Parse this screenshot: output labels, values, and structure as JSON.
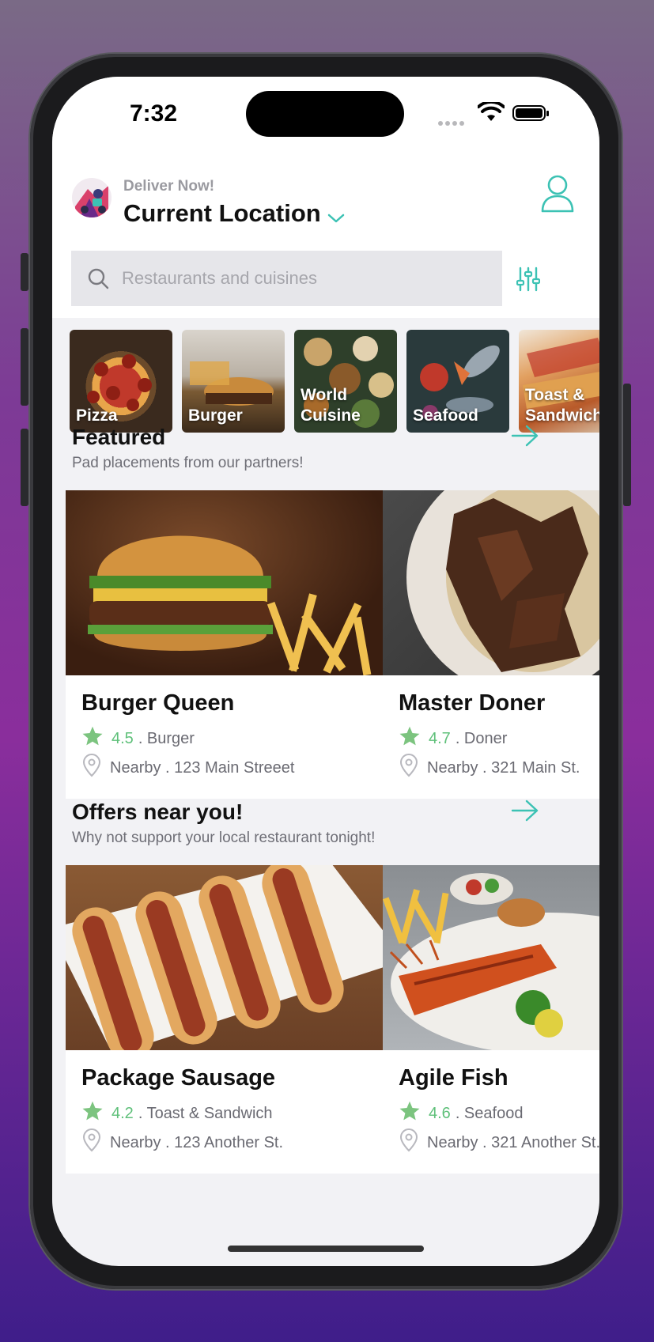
{
  "status_bar": {
    "time": "7:32"
  },
  "header": {
    "deliver_label": "Deliver Now!",
    "location": "Current Location",
    "search_placeholder": "Restaurants and cuisines"
  },
  "categories": [
    {
      "label": "Pizza"
    },
    {
      "label": "Burger"
    },
    {
      "label": "World Cuisine"
    },
    {
      "label": "Seafood"
    },
    {
      "label": "Toast & Sandwich"
    }
  ],
  "featured": {
    "title": "Featured",
    "subtitle": "Pad placements from our partners!",
    "cards": [
      {
        "name": "Burger Queen",
        "rating": "4.5",
        "cuisine": ". Burger",
        "address": "Nearby . 123 Main Streeet"
      },
      {
        "name": "Master Doner",
        "rating": "4.7",
        "cuisine": ". Doner",
        "address": "Nearby . 321 Main St."
      }
    ]
  },
  "offers": {
    "title": "Offers near you!",
    "subtitle": "Why not support your local restaurant tonight!",
    "cards": [
      {
        "name": "Package Sausage",
        "rating": "4.2",
        "cuisine": ". Toast & Sandwich",
        "address": "Nearby . 123 Another St."
      },
      {
        "name": "Agile Fish",
        "rating": "4.6",
        "cuisine": ". Seafood",
        "address": "Nearby . 321 Another St."
      }
    ]
  },
  "icons": {
    "search": "search-icon",
    "filter": "sliders-icon",
    "profile": "user-icon",
    "arrow": "arrow-right-icon",
    "star": "star-icon",
    "pin": "location-pin-icon",
    "chevron": "chevron-down-icon"
  },
  "colors": {
    "accent": "#3cc2b4",
    "rating": "#5fc07a",
    "star": "#7cc47f"
  }
}
